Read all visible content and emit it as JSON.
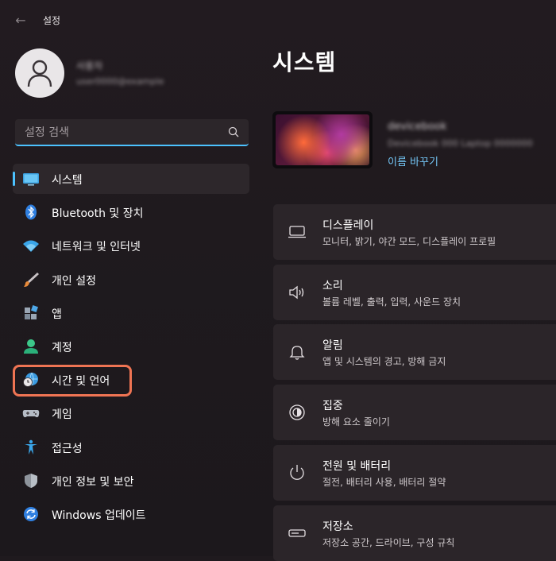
{
  "window": {
    "title": "설정"
  },
  "search": {
    "placeholder": "설정 검색"
  },
  "sidebar": {
    "items": [
      {
        "label": "시스템",
        "icon": "monitor-icon",
        "active": true
      },
      {
        "label": "Bluetooth 및 장치",
        "icon": "bluetooth-icon"
      },
      {
        "label": "네트워크 및 인터넷",
        "icon": "wifi-icon"
      },
      {
        "label": "개인 설정",
        "icon": "brush-icon"
      },
      {
        "label": "앱",
        "icon": "apps-icon"
      },
      {
        "label": "계정",
        "icon": "account-icon"
      },
      {
        "label": "시간 및 언어",
        "icon": "globe-clock-icon",
        "highlighted": true
      },
      {
        "label": "게임",
        "icon": "gamepad-icon"
      },
      {
        "label": "접근성",
        "icon": "accessibility-icon"
      },
      {
        "label": "개인 정보 및 보안",
        "icon": "shield-icon"
      },
      {
        "label": "Windows 업데이트",
        "icon": "update-icon"
      }
    ]
  },
  "main": {
    "title": "시스템",
    "device": {
      "rename_label": "이름 바꾸기"
    },
    "cards": [
      {
        "title": "디스플레이",
        "subtitle": "모니터, 밝기, 야간 모드, 디스플레이 프로필",
        "icon": "display-icon"
      },
      {
        "title": "소리",
        "subtitle": "볼륨 레벨, 출력, 입력, 사운드 장치",
        "icon": "speaker-icon"
      },
      {
        "title": "알림",
        "subtitle": "앱 및 시스템의 경고, 방해 금지",
        "icon": "bell-icon"
      },
      {
        "title": "집중",
        "subtitle": "방해 요소 줄이기",
        "icon": "focus-icon"
      },
      {
        "title": "전원 및 배터리",
        "subtitle": "절전, 배터리 사용, 배터리 절약",
        "icon": "power-icon"
      },
      {
        "title": "저장소",
        "subtitle": "저장소 공간, 드라이브, 구성 규칙",
        "icon": "storage-icon"
      }
    ]
  },
  "colors": {
    "accent": "#4cc2ff",
    "highlight": "#ef7453",
    "link": "#74c6f6"
  }
}
